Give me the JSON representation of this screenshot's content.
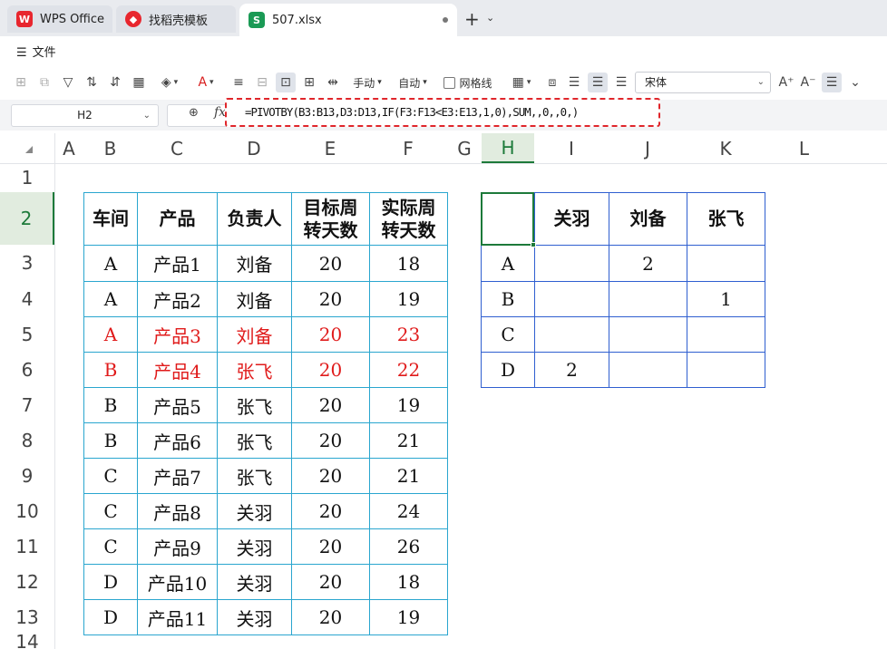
{
  "tabs": [
    {
      "label": "WPS Office",
      "icon": "wps-logo-icon"
    },
    {
      "label": "找稻壳模板",
      "icon": "docer-icon"
    },
    {
      "label": "507.xlsx",
      "icon": "spreadsheet-icon",
      "icon_text": "S"
    }
  ],
  "menu": {
    "file_label": "文件"
  },
  "toolbar": {
    "manual_label": "手动",
    "auto_label": "自动",
    "gridlines_label": "网格线",
    "font_name": "宋体"
  },
  "formula_bar": {
    "cell_ref": "H2",
    "formula": "=PIVOTBY(B3:B13,D3:D13,IF(F3:F13<E3:E13,1,0),SUM,,0,,0,)"
  },
  "grid": {
    "columns": [
      "A",
      "B",
      "C",
      "D",
      "E",
      "F",
      "G",
      "H",
      "I",
      "J",
      "K",
      "L"
    ],
    "rows": [
      "1",
      "2",
      "3",
      "4",
      "5",
      "6",
      "7",
      "8",
      "9",
      "10",
      "11",
      "12",
      "13",
      "14"
    ],
    "selected_column": "H",
    "selected_row": "2"
  },
  "source_table": {
    "headers": [
      "车间",
      "产品",
      "负责人",
      "目标周转天数",
      "实际周转天数"
    ],
    "header_lines": [
      [
        "车间"
      ],
      [
        "产品"
      ],
      [
        "负责人"
      ],
      [
        "目标周",
        "转天数"
      ],
      [
        "实际周",
        "转天数"
      ]
    ],
    "rows": [
      [
        "A",
        "产品1",
        "刘备",
        "20",
        "18"
      ],
      [
        "A",
        "产品2",
        "刘备",
        "20",
        "19"
      ],
      [
        "A",
        "产品3",
        "刘备",
        "20",
        "23"
      ],
      [
        "B",
        "产品4",
        "张飞",
        "20",
        "22"
      ],
      [
        "B",
        "产品5",
        "张飞",
        "20",
        "19"
      ],
      [
        "B",
        "产品6",
        "张飞",
        "20",
        "21"
      ],
      [
        "C",
        "产品7",
        "张飞",
        "20",
        "21"
      ],
      [
        "C",
        "产品8",
        "关羽",
        "20",
        "24"
      ],
      [
        "C",
        "产品9",
        "关羽",
        "20",
        "26"
      ],
      [
        "D",
        "产品10",
        "关羽",
        "20",
        "18"
      ],
      [
        "D",
        "产品11",
        "关羽",
        "20",
        "19"
      ]
    ],
    "highlight_rows": [
      2,
      3
    ],
    "highlight_color": "#e01b1b"
  },
  "pivot_table": {
    "headers": [
      "",
      "关羽",
      "刘备",
      "张飞"
    ],
    "rows": [
      [
        "A",
        "",
        "2",
        ""
      ],
      [
        "B",
        "",
        "",
        "1"
      ],
      [
        "C",
        "",
        "",
        ""
      ],
      [
        "D",
        "2",
        "",
        ""
      ]
    ]
  }
}
